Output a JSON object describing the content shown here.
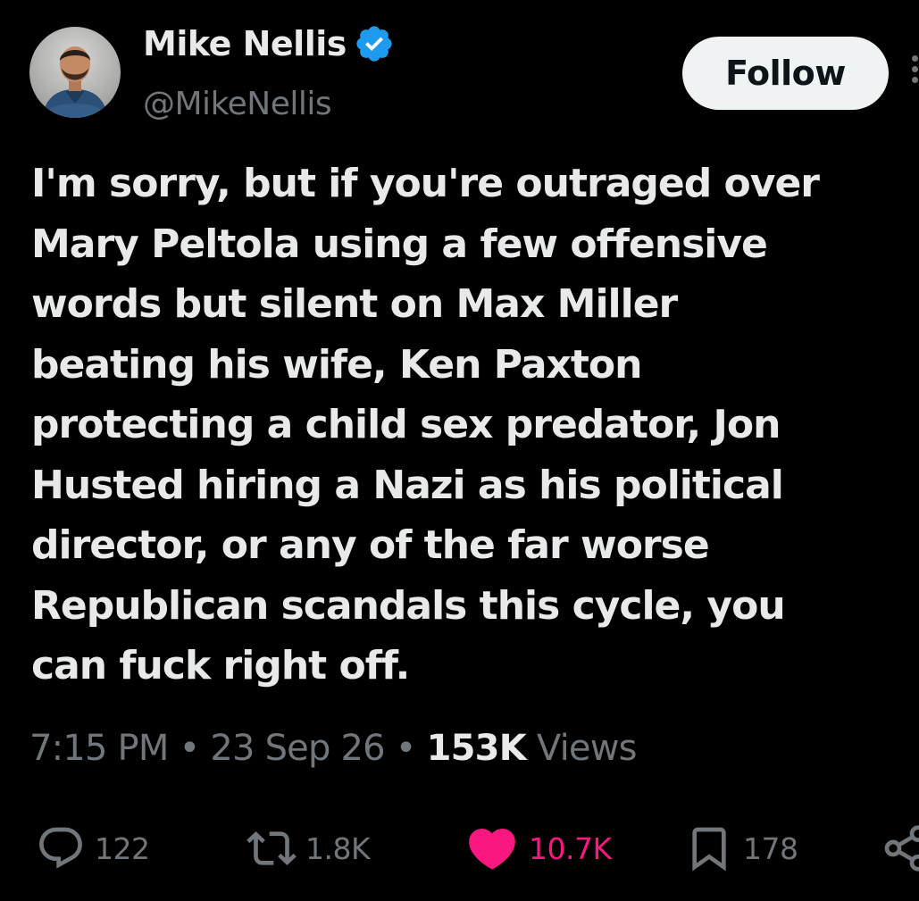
{
  "user": {
    "name": "Mike Nellis",
    "handle": "@MikeNellis",
    "verified": true
  },
  "follow_button": {
    "label": "Follow"
  },
  "tweet": {
    "text_lines": [
      "I'm sorry, but if you're outraged over",
      "Mary Peltola using a few offensive",
      "words but silent on Max Miller",
      "beating his wife, Ken Paxton",
      "protecting a child sex predator, Jon",
      "Husted hiring a Nazi as his political",
      "director, or any of the far worse",
      "Republican scandals this cycle, you",
      "can fuck right off."
    ]
  },
  "meta": {
    "time": "7:15 PM",
    "separator": "•",
    "date": "23 Sep 26",
    "views_count": "153K",
    "views_label": "Views"
  },
  "actions": {
    "replies": "122",
    "reposts": "1.8K",
    "likes": "10.7K",
    "bookmarks": "178"
  },
  "icons": {
    "verified": "verified-badge-icon",
    "reply": "reply-icon",
    "repost": "repost-icon",
    "like": "heart-icon",
    "bookmark": "bookmark-icon",
    "share": "share-icon",
    "more": "more-icon"
  },
  "colors": {
    "background": "#000000",
    "text_primary": "#e7e9ea",
    "text_secondary": "#71767b",
    "verified_blue": "#1d9bf0",
    "like_pink": "#f91880",
    "follow_bg": "#eff3f4"
  }
}
